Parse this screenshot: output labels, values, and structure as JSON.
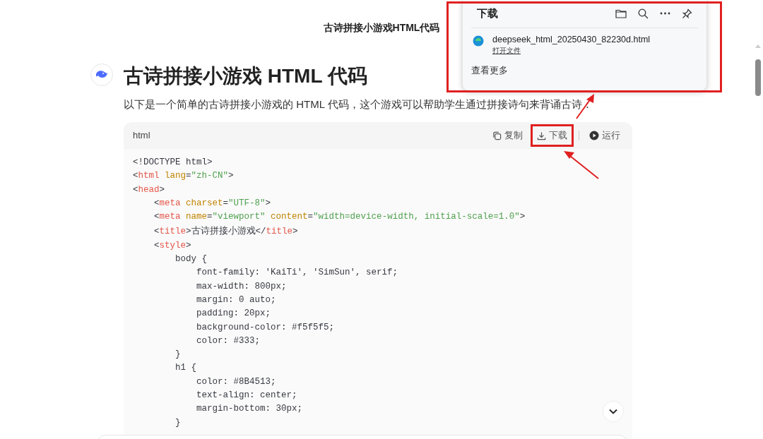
{
  "page_title": "古诗拼接小游戏HTML代码",
  "heading": "古诗拼接小游戏 HTML 代码",
  "intro": "以下是一个简单的古诗拼接小游戏的 HTML 代码，这个游戏可以帮助学生通过拼接诗句来背诵古诗：",
  "code_block": {
    "language": "html",
    "actions": [
      {
        "kind": "copy",
        "label": "复制"
      },
      {
        "kind": "download",
        "label": "下载"
      },
      {
        "kind": "run",
        "label": "运行"
      }
    ],
    "lines": [
      [
        {
          "kind": "punct",
          "text": "<!DOCTYPE html>"
        }
      ],
      [
        {
          "kind": "punct",
          "text": "<"
        },
        {
          "kind": "tag",
          "text": "html"
        },
        {
          "kind": "attr",
          "text": " lang"
        },
        {
          "kind": "punct",
          "text": "="
        },
        {
          "kind": "string",
          "text": "\"zh-CN\""
        },
        {
          "kind": "punct",
          "text": ">"
        }
      ],
      [
        {
          "kind": "punct",
          "text": "<"
        },
        {
          "kind": "tag",
          "text": "head"
        },
        {
          "kind": "punct",
          "text": ">"
        }
      ],
      [
        {
          "kind": "punct",
          "text": "    <"
        },
        {
          "kind": "tag",
          "text": "meta"
        },
        {
          "kind": "attr",
          "text": " charset"
        },
        {
          "kind": "punct",
          "text": "="
        },
        {
          "kind": "string",
          "text": "\"UTF-8\""
        },
        {
          "kind": "punct",
          "text": ">"
        }
      ],
      [
        {
          "kind": "punct",
          "text": "    <"
        },
        {
          "kind": "tag",
          "text": "meta"
        },
        {
          "kind": "attr",
          "text": " name"
        },
        {
          "kind": "punct",
          "text": "="
        },
        {
          "kind": "string",
          "text": "\"viewport\""
        },
        {
          "kind": "attr",
          "text": " content"
        },
        {
          "kind": "punct",
          "text": "="
        },
        {
          "kind": "string",
          "text": "\"width=device-width, initial-scale=1.0\""
        },
        {
          "kind": "punct",
          "text": ">"
        }
      ],
      [
        {
          "kind": "punct",
          "text": "    <"
        },
        {
          "kind": "tag",
          "text": "title"
        },
        {
          "kind": "punct",
          "text": ">"
        },
        {
          "kind": "cjk",
          "text": "古诗拼接小游戏"
        },
        {
          "kind": "punct",
          "text": "</"
        },
        {
          "kind": "tag",
          "text": "title"
        },
        {
          "kind": "punct",
          "text": ">"
        }
      ],
      [
        {
          "kind": "punct",
          "text": "    <"
        },
        {
          "kind": "tag",
          "text": "style"
        },
        {
          "kind": "punct",
          "text": ">"
        }
      ],
      [
        {
          "kind": "punct",
          "text": "        body {"
        }
      ],
      [
        {
          "kind": "punct",
          "text": "            font-family: 'KaiTi', 'SimSun', serif;"
        }
      ],
      [
        {
          "kind": "punct",
          "text": "            max-width: 800px;"
        }
      ],
      [
        {
          "kind": "punct",
          "text": "            margin: 0 auto;"
        }
      ],
      [
        {
          "kind": "punct",
          "text": "            padding: 20px;"
        }
      ],
      [
        {
          "kind": "punct",
          "text": "            background-color: #f5f5f5;"
        }
      ],
      [
        {
          "kind": "punct",
          "text": "            color: #333;"
        }
      ],
      [
        {
          "kind": "punct",
          "text": "        }"
        }
      ],
      [
        {
          "kind": "punct",
          "text": "        h1 {"
        }
      ],
      [
        {
          "kind": "punct",
          "text": "            color: #8B4513;"
        }
      ],
      [
        {
          "kind": "punct",
          "text": "            text-align: center;"
        }
      ],
      [
        {
          "kind": "punct",
          "text": "            margin-bottom: 30px;"
        }
      ],
      [
        {
          "kind": "punct",
          "text": "        }"
        }
      ]
    ]
  },
  "download_panel": {
    "title": "下载",
    "file_name": "deepseek_html_20250430_82230d.html",
    "open_file": "打开文件",
    "see_more": "查看更多"
  }
}
